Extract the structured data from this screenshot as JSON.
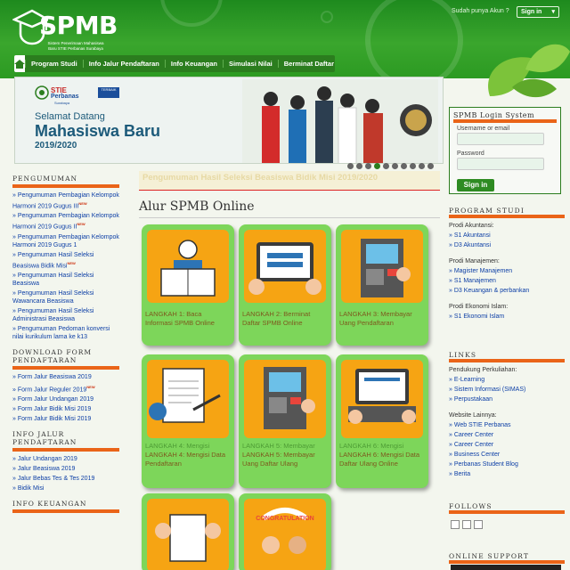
{
  "header": {
    "logo_text": "SPMB",
    "logo_sub": "Sistem Penerimaan Mahasiswa Baru STIE Perbanas Surabaya",
    "login_question": "Sudah punya Akun ?",
    "signin_label": "Sign in"
  },
  "nav": {
    "items": [
      "Program Studi",
      "Info Jalur Pendaftaran",
      "Info Keuangan",
      "Simulasi Nilai",
      "Berminat Daftar"
    ]
  },
  "banner": {
    "brand1": "STIE",
    "brand2": "Perbanas",
    "brand3": "Surabaya",
    "badge": "TERBAIK",
    "welcome": "Selamat Datang",
    "headline": "Mahasiswa Baru",
    "year": "2019/2020"
  },
  "ticker": "Pengumuman Hasil Seleksi Beasiswa Bidik Misi 2019/2020",
  "main_title": "Alur SPMB Online",
  "steps": [
    {
      "label": "LANGKAH 1: Baca Informasi SPMB Online"
    },
    {
      "label": "LANGKAH 2: Berminat Daftar SPMB Online"
    },
    {
      "label": "LANGKAH 3: Membayar Uang Pendaftaran"
    },
    {
      "label": "LANGKAH 4: Mengisi Data Pendaftaran"
    },
    {
      "label": "LANGKAH 5: Membayar Uang Daftar Ulang"
    },
    {
      "label": "LANGKAH 6: Mengisi Data Daftar Ulang Online"
    },
    {
      "label": ""
    },
    {
      "label": ""
    }
  ],
  "left": {
    "pengumuman_title": "PENGUMUMAN",
    "pengumuman": [
      {
        "text": "» Pengumuman Pembagian Kelompok Harmoni 2019 Gugus III",
        "new": "NEW"
      },
      {
        "text": "» Pengumuman Pembagian Kelompok Harmoni 2019 Gugus II",
        "new": "NEW"
      },
      {
        "text": "» Pengumuman Pembagian Kelompok Harmoni 2019 Gugus 1",
        "new": ""
      },
      {
        "text": "» Pengumuman Hasil Seleksi Beasiswa Bidik Misi",
        "new": "NEW"
      },
      {
        "text": "» Pengumuman Hasil Seleksi Beasiswa",
        "new": ""
      },
      {
        "text": "» Pengumuman Hasil Seleksi Wawancara Beasiswa",
        "new": ""
      },
      {
        "text": "» Pengumuman Hasil Seleksi Administrasi Beasiswa",
        "new": ""
      },
      {
        "text": "» Pengumuman Pedoman konversi nilai kurikulum lama ke k13",
        "new": ""
      }
    ],
    "download_title": "DOWNLOAD FORM PENDAFTARAN",
    "download": [
      {
        "text": "» Form Jalur Beasiswa 2019",
        "new": ""
      },
      {
        "text": "» Form Jalur Reguler 2019",
        "new": "NEW"
      },
      {
        "text": "» Form Jalur Undangan 2019",
        "new": ""
      },
      {
        "text": "» Form Jalur Bidik Misi 2019",
        "new": ""
      },
      {
        "text": "» Form Jalur Bidik Misi 2019",
        "new": ""
      }
    ],
    "info_title": "INFO JALUR PENDAFTARAN",
    "info": [
      "» Jalur Undangan 2019",
      "» Jalur Beasiswa 2019",
      "» Jalur Bebas Tes & Tes 2019",
      "» Bidik Misi"
    ],
    "keuangan_title": "INFO KEUANGAN"
  },
  "right": {
    "login_title": "SPMB Login System",
    "username_label": "Username or email",
    "password_label": "Password",
    "signin_label": "Sign in",
    "program_title": "PROGRAM STUDI",
    "program": [
      {
        "type": "h",
        "text": "Prodi Akuntansi:"
      },
      {
        "type": "l",
        "text": "» S1 Akuntansi"
      },
      {
        "type": "l",
        "text": "» D3 Akuntansi"
      },
      {
        "type": "g"
      },
      {
        "type": "h",
        "text": "Prodi Manajemen:"
      },
      {
        "type": "l",
        "text": "» Magister Manajemen"
      },
      {
        "type": "l",
        "text": "» S1 Manajemen"
      },
      {
        "type": "l",
        "text": "» D3 Keuangan & perbankan"
      },
      {
        "type": "g"
      },
      {
        "type": "h",
        "text": "Prodi Ekonomi Islam:"
      },
      {
        "type": "l",
        "text": "» S1 Ekonomi Islam"
      }
    ],
    "links_title": "LINKS",
    "links": [
      {
        "type": "h",
        "text": "Pendukung Perkuliahan:"
      },
      {
        "type": "l",
        "text": "» E-Learning"
      },
      {
        "type": "l",
        "text": "» Sistem Informasi (SIMAS)"
      },
      {
        "type": "l",
        "text": "» Perpustakaan"
      },
      {
        "type": "g"
      },
      {
        "type": "h",
        "text": "Website Lainnya:"
      },
      {
        "type": "l",
        "text": "» Web STIE Perbanas"
      },
      {
        "type": "l",
        "text": "» Career Center"
      },
      {
        "type": "l",
        "text": "» Career Center"
      },
      {
        "type": "l",
        "text": "» Business Center"
      },
      {
        "type": "l",
        "text": "» Perbanas Student Blog"
      },
      {
        "type": "l",
        "text": "» Berita"
      }
    ],
    "follows_title": "FOLLOWS",
    "online_title": "ONLINE SUPPORT"
  }
}
